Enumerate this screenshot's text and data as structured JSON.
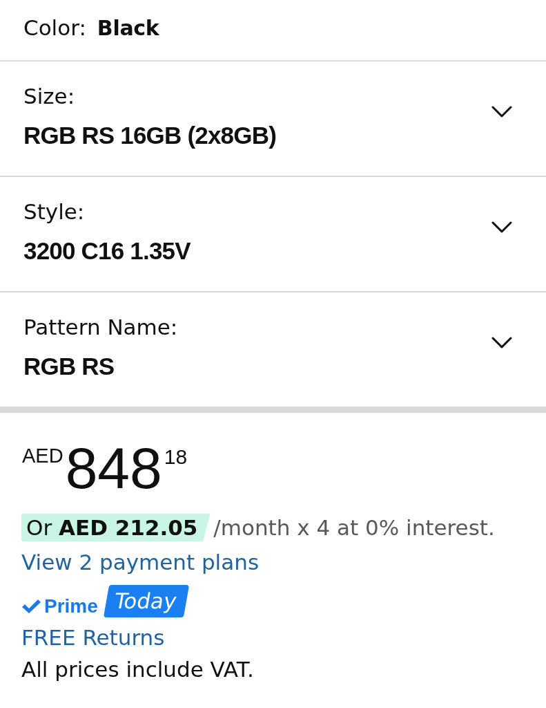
{
  "variations": [
    {
      "kind": "inline",
      "label": "Color:",
      "value": "Black"
    },
    {
      "kind": "dropdown",
      "label": "Size:",
      "value": "RGB RS 16GB (2x8GB)"
    },
    {
      "kind": "dropdown",
      "label": "Style:",
      "value": "3200 C16 1.35V"
    },
    {
      "kind": "dropdown",
      "label": "Pattern Name:",
      "value": "RGB RS"
    }
  ],
  "price": {
    "currency": "AED",
    "whole": "848",
    "fraction": "18"
  },
  "installment": {
    "highlight": "Or **AED 212.05**",
    "rest": "/month x 4 at 0% interest."
  },
  "payment_plans_link": "View 2 payment plans",
  "delivery": {
    "prime": "Prime",
    "badge": "Today"
  },
  "returns_link": "FREE Returns",
  "vat_note": "All prices include VAT."
}
